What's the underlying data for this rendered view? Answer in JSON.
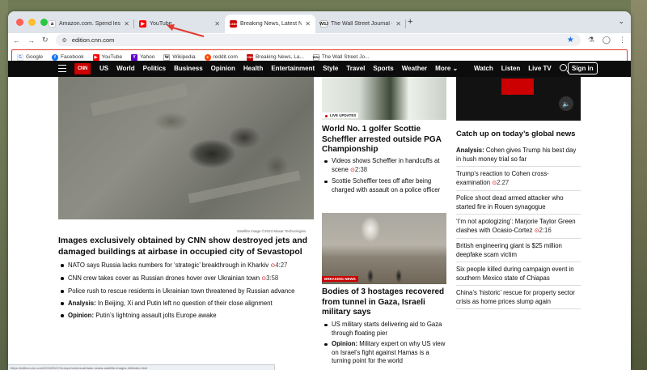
{
  "browser": {
    "tabs": [
      {
        "title": "Amazon.com. Spend less. Sm",
        "favicon": "amazon-favicon"
      },
      {
        "title": "YouTube",
        "favicon": "youtube-favicon"
      },
      {
        "title": "Breaking News, Latest News",
        "favicon": "cnn-favicon",
        "active": true
      },
      {
        "title": "The Wall Street Journal - Bre",
        "favicon": "wsj-favicon"
      }
    ],
    "url": "edition.cnn.com",
    "bookmarks": [
      {
        "label": "Google"
      },
      {
        "label": "Facebook"
      },
      {
        "label": "YouTube"
      },
      {
        "label": "Yahoo"
      },
      {
        "label": "Wikipedia"
      },
      {
        "label": "reddit.com"
      },
      {
        "label": "Breaking News, La..."
      },
      {
        "label": "The Wall Street Jo..."
      }
    ],
    "status_text": "https://edition.cnn.com/2024/05/17/europe/crimea-airbase-russia-satellite-images-intl/index.html"
  },
  "nav": {
    "logo": "CNN",
    "items": [
      "US",
      "World",
      "Politics",
      "Business",
      "Opinion",
      "Health",
      "Entertainment",
      "Style",
      "Travel",
      "Sports",
      "Weather",
      "More"
    ],
    "right": [
      "Watch",
      "Listen",
      "Live TV"
    ],
    "signin": "Sign in"
  },
  "main": {
    "image_caption": "Satellite image ©2024 Maxar Technologies",
    "headline": "Images exclusively obtained by CNN show destroyed jets and damaged buildings at airbase in occupied city of Sevastopol",
    "bullets": [
      {
        "text": "NATO says Russia lacks numbers for ‘strategic’ breakthrough in Kharkiv",
        "duration": "4:27"
      },
      {
        "text": "CNN crew takes cover as Russian drones hover over Ukrainian town",
        "duration": "3:58"
      },
      {
        "text": "Police rush to rescue residents in Ukrainian town threatened by Russian advance"
      },
      {
        "prefix": "Analysis:",
        "text": "In Beijing, Xi and Putin left no question of their close alignment"
      },
      {
        "prefix": "Opinion:",
        "text": "Putin’s lightning assault jolts Europe awake"
      }
    ]
  },
  "middle": {
    "live_label": "LIVE UPDATES",
    "headline1": "World No. 1 golfer Scottie Scheffler arrested outside PGA Championship",
    "bullets1": [
      {
        "text": "Videos shows Scheffler in handcuffs at scene",
        "duration": "2:38"
      },
      {
        "text": "Scottie Scheffler tees off after being charged with assault on a police officer"
      }
    ],
    "breaking_label": "BREAKING NEWS",
    "headline2": "Bodies of 3 hostages recovered from tunnel in Gaza, Israeli military says",
    "bullets2": [
      {
        "text": "US military starts delivering aid to Gaza through floating pier"
      },
      {
        "prefix": "Opinion:",
        "text": "Military expert on why US view on Israel’s fight against Hamas is a turning point for the world"
      }
    ]
  },
  "right": {
    "heading": "Catch up on today’s global news",
    "items": [
      {
        "prefix": "Analysis:",
        "text": "Cohen gives Trump his best day in hush money trial so far"
      },
      {
        "text": "Trump’s reaction to Cohen cross-examination",
        "duration": "2:27"
      },
      {
        "text": "Police shoot dead armed attacker who started fire in Rouen synagogue"
      },
      {
        "text": "‘I’m not apologizing’: Marjorie Taylor Green clashes with Ocasio-Cortez",
        "duration": "2:16"
      },
      {
        "text": "British engineering giant is $25 million deepfake scam victim"
      },
      {
        "text": "Six people killed during campaign event in southern Mexico state of Chiapas"
      },
      {
        "text": "China’s ‘historic’ rescue for property sector crisis as home prices slump again"
      }
    ]
  },
  "colors": {
    "cnn_red": "#cc0000",
    "nav_bg": "#0c0c0c",
    "annotation": "#e23b2e"
  }
}
